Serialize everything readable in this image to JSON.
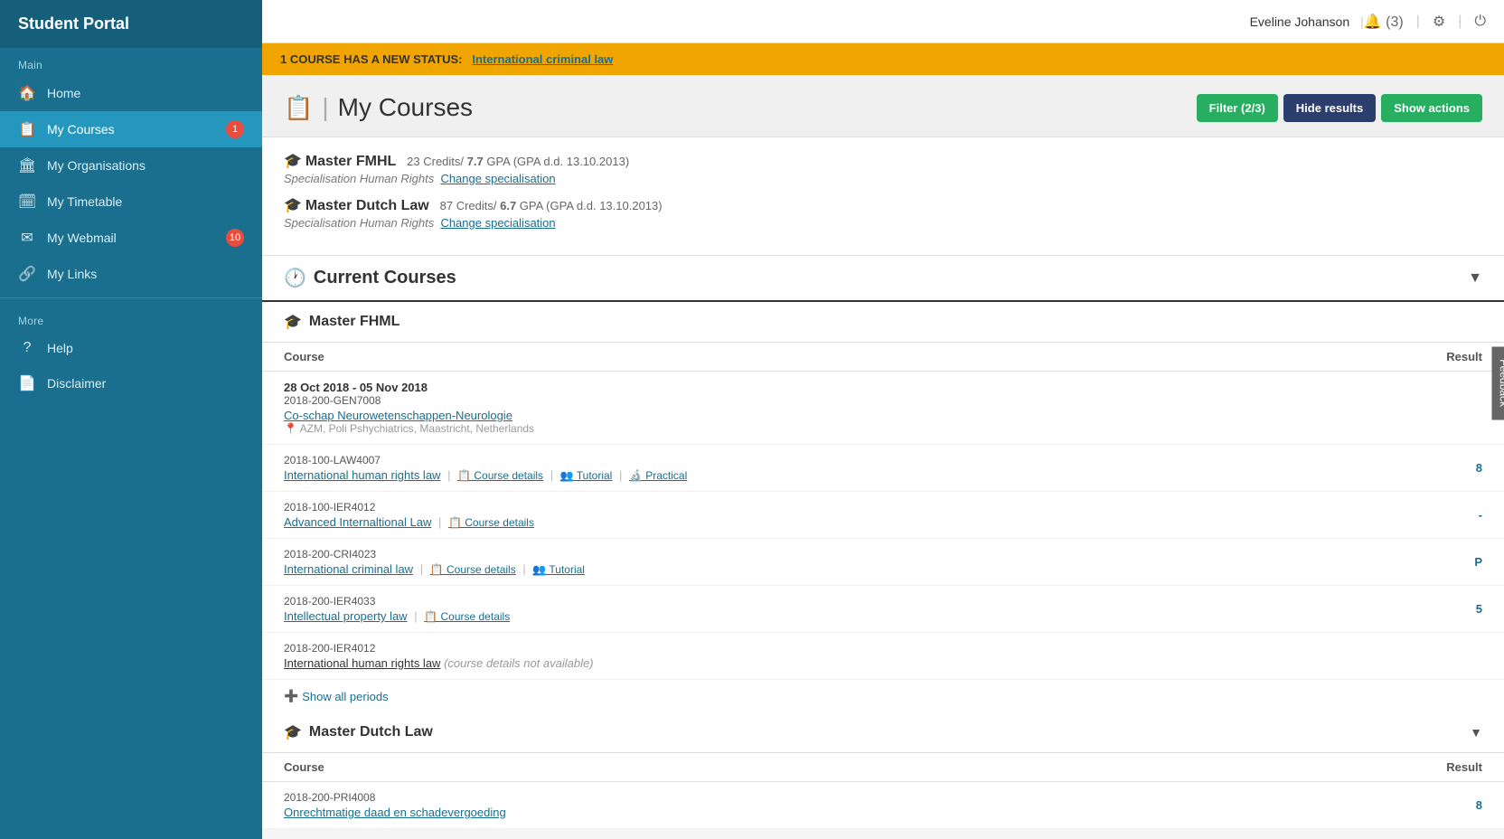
{
  "app": {
    "title": "Student Portal"
  },
  "topbar": {
    "user": "Eveline Johanson",
    "notifications": "(3)"
  },
  "notification": {
    "prefix": "1 COURSE HAS A NEW STATUS:",
    "link": "International criminal law"
  },
  "sidebar": {
    "main_label": "Main",
    "more_label": "More",
    "nav_items": [
      {
        "id": "home",
        "icon": "🏠",
        "label": "Home",
        "active": false,
        "badge": null
      },
      {
        "id": "my-courses",
        "icon": "📋",
        "label": "My Courses",
        "active": true,
        "badge": "1"
      },
      {
        "id": "my-organisations",
        "icon": "🏛",
        "label": "My Organisations",
        "active": false,
        "badge": null
      },
      {
        "id": "my-timetable",
        "icon": "🗓",
        "label": "My Timetable",
        "active": false,
        "badge": null
      },
      {
        "id": "my-webmail",
        "icon": "✉",
        "label": "My Webmail",
        "active": false,
        "badge": "10"
      },
      {
        "id": "my-links",
        "icon": "🔗",
        "label": "My Links",
        "active": false,
        "badge": null
      }
    ],
    "more_items": [
      {
        "id": "help",
        "icon": "?",
        "label": "Help"
      },
      {
        "id": "disclaimer",
        "icon": "📄",
        "label": "Disclaimer"
      }
    ]
  },
  "page": {
    "icon": "📋",
    "title": "My Courses"
  },
  "toolbar": {
    "filter_label": "Filter (2/3)",
    "hide_label": "Hide results",
    "actions_label": "Show actions"
  },
  "master_fmhl": {
    "name": "Master FMHL",
    "credits": "23",
    "gpa": "7.7",
    "gpa_date": "13.10.2013",
    "specialisation": "Specialisation Human Rights",
    "change_link": "Change specialisation"
  },
  "master_dutch_law": {
    "name": "Master Dutch Law",
    "credits": "87",
    "gpa": "6.7",
    "gpa_date": "13.10.2013",
    "specialisation": "Specialisation Human Rights",
    "change_link": "Change specialisation"
  },
  "current_courses_label": "Current Courses",
  "course_col_label": "Course",
  "result_col_label": "Result",
  "fmhl_section": {
    "title": "Master FHML",
    "rows": [
      {
        "date_range": "28 Oct 2018 - 05 Nov 2018",
        "code": "2018-200-GEN7008",
        "course_name": "Co-schap Neurowetenschappen-Neurologie",
        "location": "AZM, Poli Pshychiatrics, Maastricht, Netherlands",
        "links": [],
        "result": ""
      },
      {
        "date_range": "",
        "code": "2018-100-LAW4007",
        "course_name": "International human rights law",
        "location": "",
        "links": [
          "Course details",
          "Tutorial",
          "Practical"
        ],
        "result": "8"
      },
      {
        "date_range": "",
        "code": "2018-100-IER4012",
        "course_name": "Advanced Internaltional Law",
        "location": "",
        "links": [
          "Course details"
        ],
        "result": "-"
      },
      {
        "date_range": "",
        "code": "2018-200-CRI4023",
        "course_name": "International criminal law",
        "location": "",
        "links": [
          "Course details",
          "Tutorial"
        ],
        "result": "P"
      },
      {
        "date_range": "",
        "code": "2018-200-IER4033",
        "course_name": "Intellectual property law",
        "location": "",
        "links": [
          "Course details"
        ],
        "result": "5"
      },
      {
        "date_range": "",
        "code": "2018-200-IER4012",
        "course_name": "International human rights law",
        "location": "",
        "links": [],
        "note": "(course details not available)",
        "result": ""
      }
    ],
    "show_all_periods": "Show all periods"
  },
  "dutch_law_section": {
    "title": "Master Dutch Law",
    "rows": [
      {
        "code": "2018-200-PRI4008",
        "course_name": "Onrechtmatige daad en schadevergoeding",
        "result": "8"
      }
    ]
  },
  "feedback_label": "Feedback"
}
